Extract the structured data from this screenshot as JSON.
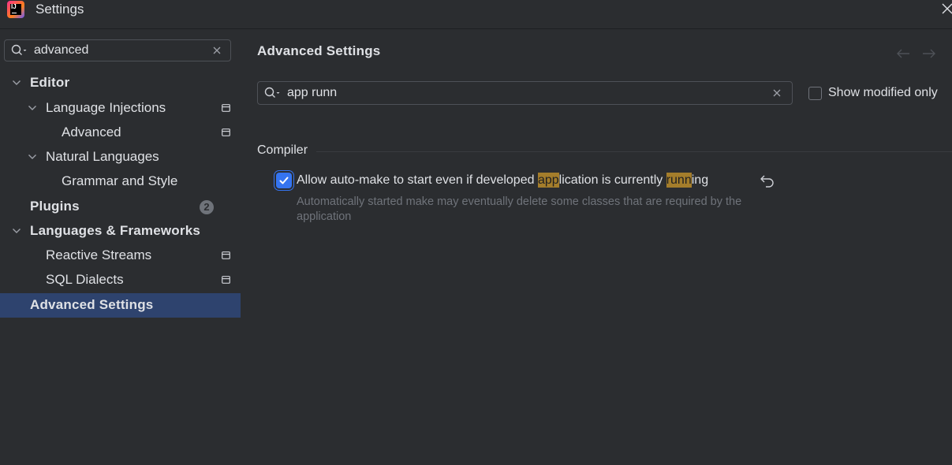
{
  "window": {
    "title": "Settings"
  },
  "sidebar": {
    "search": {
      "value": "advanced"
    },
    "items": [
      {
        "label": "Editor"
      },
      {
        "label": "Language Injections"
      },
      {
        "label": "Advanced"
      },
      {
        "label": "Natural Languages"
      },
      {
        "label": "Grammar and Style"
      },
      {
        "label": "Plugins",
        "badge": "2"
      },
      {
        "label": "Languages & Frameworks"
      },
      {
        "label": "Reactive Streams"
      },
      {
        "label": "SQL Dialects"
      },
      {
        "label": "Advanced Settings",
        "selected": true
      }
    ]
  },
  "main": {
    "title": "Advanced Settings",
    "filter": {
      "value": "app runn"
    },
    "show_modified_only": {
      "label": "Show modified only",
      "checked": false
    },
    "section": {
      "title": "Compiler"
    },
    "option": {
      "checked": true,
      "label_parts": {
        "p1": "Allow auto-make to start even if developed ",
        "h1": "app",
        "p2": "lication is currently ",
        "h2": "runn",
        "p3": "ing"
      },
      "description": "Automatically started make may eventually delete some classes that are required by the application"
    }
  },
  "icons": {
    "app": "intellij-idea-logo-icon",
    "close": "close-icon",
    "search": "search-icon",
    "clear": "clear-icon",
    "chevron": "chevron-down-icon",
    "project_scope": "project-scope-icon",
    "back": "arrow-back-icon",
    "forward": "arrow-forward-icon",
    "reset": "reset-icon"
  },
  "colors": {
    "background": "#2b2d30",
    "selection": "#2e436e",
    "accent": "#3574f0",
    "highlight": "#a47d2b",
    "muted_text": "#6f737a"
  }
}
